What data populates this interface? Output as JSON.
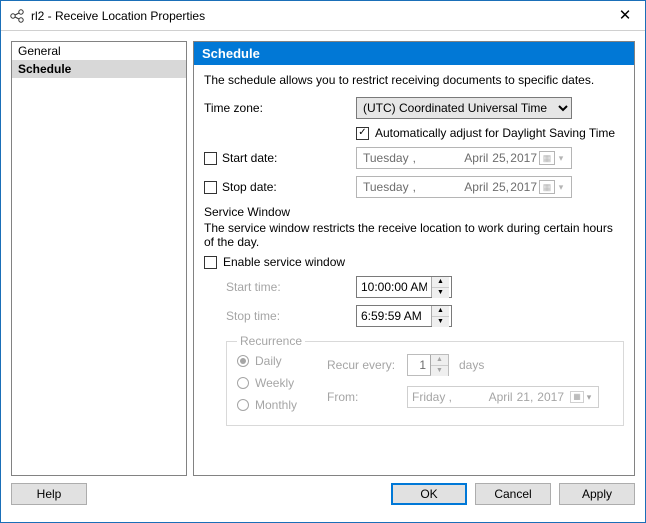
{
  "window": {
    "title": "rl2 - Receive Location Properties"
  },
  "sidebar": {
    "items": [
      {
        "label": "General",
        "selected": false
      },
      {
        "label": "Schedule",
        "selected": true
      }
    ]
  },
  "section": {
    "header": "Schedule",
    "description": "The schedule allows you to restrict receiving documents to specific dates."
  },
  "timezone": {
    "label": "Time zone:",
    "value": "(UTC) Coordinated Universal Time",
    "dst_label": "Automatically adjust for Daylight Saving Time",
    "dst_checked": true
  },
  "start_date": {
    "label": "Start date:",
    "checked": false,
    "weekday": "Tuesday",
    "month": "April",
    "day": "25,",
    "year": "2017"
  },
  "stop_date": {
    "label": "Stop date:",
    "checked": false,
    "weekday": "Tuesday",
    "month": "April",
    "day": "25,",
    "year": "2017"
  },
  "service_window": {
    "group_label": "Service Window",
    "description": "The service window restricts the receive location to work during certain hours of the day.",
    "enable_label": "Enable service window",
    "enable_checked": false,
    "start_time_label": "Start time:",
    "start_time": "10:00:00 AM",
    "stop_time_label": "Stop time:",
    "stop_time": "6:59:59 AM"
  },
  "recurrence": {
    "legend": "Recurrence",
    "options": {
      "daily": "Daily",
      "weekly": "Weekly",
      "monthly": "Monthly"
    },
    "selected": "daily",
    "recur_label": "Recur every:",
    "recur_value": "1",
    "recur_unit": "days",
    "from_label": "From:",
    "from_weekday": "Friday",
    "from_month": "April",
    "from_day": "21,",
    "from_year": "2017"
  },
  "footer": {
    "help": "Help",
    "ok": "OK",
    "cancel": "Cancel",
    "apply": "Apply"
  }
}
